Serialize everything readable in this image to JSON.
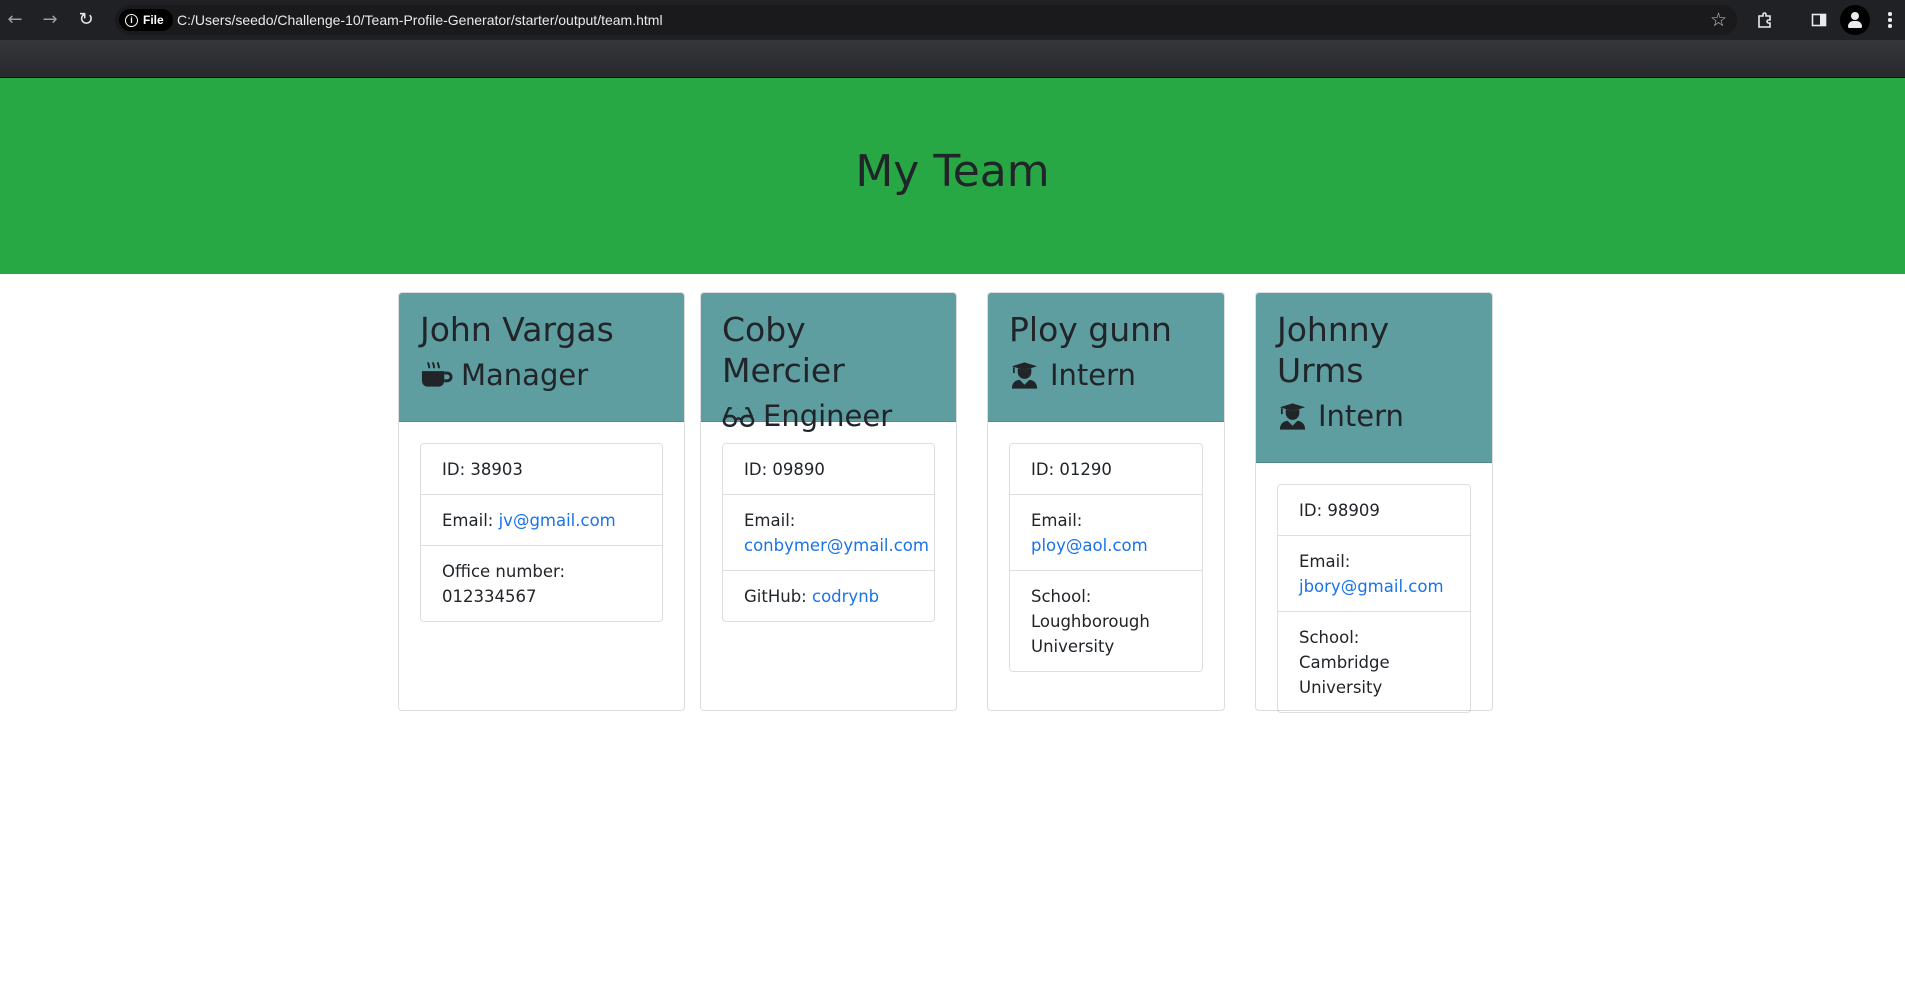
{
  "browser": {
    "url_chip": "File",
    "url": "C:/Users/seedo/Challenge-10/Team-Profile-Generator/starter/output/team.html"
  },
  "page": {
    "title": "My Team"
  },
  "team": [
    {
      "name": "John Vargas",
      "role": "Manager",
      "icon": "mug-icon",
      "id_label": "ID:",
      "id": "38903",
      "email_label": "Email:",
      "email": "jv@gmail.com",
      "extra_label": "Office number:",
      "extra": "012334567"
    },
    {
      "name": "Coby Mercier",
      "role": "Engineer",
      "icon": "glasses-icon",
      "id_label": "ID:",
      "id": "09890",
      "email_label": "Email:",
      "email": "conbymer@ymail.com",
      "extra_label": "GitHub:",
      "extra": "codrynb"
    },
    {
      "name": "Ploy gunn",
      "role": "Intern",
      "icon": "graduate-icon",
      "id_label": "ID:",
      "id": "01290",
      "email_label": "Email:",
      "email": "ploy@aol.com",
      "extra_label": "School:",
      "extra": "Loughborough University"
    },
    {
      "name": "Johnny Urms",
      "role": "Intern",
      "icon": "graduate-icon",
      "id_label": "ID:",
      "id": "98909",
      "email_label": "Email:",
      "email": "jbory@gmail.com",
      "extra_label": "School:",
      "extra": "Cambridge University"
    }
  ],
  "colors": {
    "header_bg": "#28a745",
    "card_header_bg": "#5f9ea0",
    "link": "#1a73e8"
  }
}
